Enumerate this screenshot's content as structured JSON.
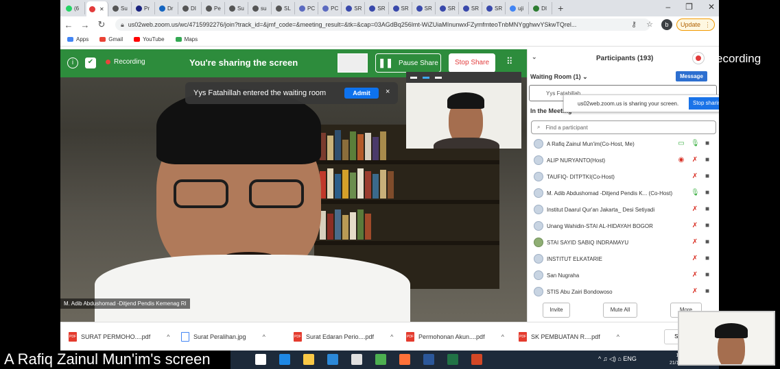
{
  "browser": {
    "tabs": [
      {
        "label": "(6",
        "color": "#25d366"
      },
      {
        "label": "",
        "color": "#e23b3b",
        "active": true
      },
      {
        "label": "Su",
        "color": "#555"
      },
      {
        "label": "Pr",
        "color": "#1a237e"
      },
      {
        "label": "Dr",
        "color": "#1565c0"
      },
      {
        "label": "DI",
        "color": "#555"
      },
      {
        "label": "Pe",
        "color": "#555"
      },
      {
        "label": "Su",
        "color": "#555"
      },
      {
        "label": "su",
        "color": "#555"
      },
      {
        "label": "SL",
        "color": "#555"
      },
      {
        "label": "PC",
        "color": "#5c6bc0"
      },
      {
        "label": "PC",
        "color": "#5c6bc0"
      },
      {
        "label": "SR",
        "color": "#3949ab"
      },
      {
        "label": "SR",
        "color": "#3949ab"
      },
      {
        "label": "SR",
        "color": "#3949ab"
      },
      {
        "label": "SR",
        "color": "#3949ab"
      },
      {
        "label": "SR",
        "color": "#3949ab"
      },
      {
        "label": "SR",
        "color": "#3949ab"
      },
      {
        "label": "SR",
        "color": "#3949ab"
      },
      {
        "label": "uji",
        "color": "#4285f4"
      },
      {
        "label": "DI",
        "color": "#2e7d32"
      }
    ],
    "new_tab": "+",
    "window_controls": [
      "–",
      "❐",
      "✕"
    ],
    "url": "us02web.zoom.us/wc/4715992276/join?track_id=&jmf_code=&meeting_result=&tk=&cap=03AGdBq256lmt-WiZUiaMInunwxFZymfmteoTnbMNYgghwvYSkwTQrel...",
    "profile_initial": "b",
    "update_label": "Update",
    "bookmarks": [
      {
        "label": "Apps",
        "color": "#4285f4"
      },
      {
        "label": "Gmail",
        "color": "#ea4335"
      },
      {
        "label": "YouTube",
        "color": "#ff0000"
      },
      {
        "label": "Maps",
        "color": "#34a853"
      }
    ]
  },
  "zoom": {
    "share_bar": {
      "recording": "Recording",
      "title": "You're sharing the screen",
      "pause": "Pause Share",
      "stop": "Stop Share"
    },
    "notification": {
      "text": "Yys Fatahillah entered the waiting room",
      "admit": "Admit",
      "close": "×"
    },
    "video_label": "M. Adib Abdushomad -Ditjend Pendis Kemenag RI"
  },
  "participants_panel": {
    "title": "Participants (193)",
    "waiting_room": "Waiting Room (1)",
    "message_btn": "Message",
    "waiting_name": "Yys Fatahillah",
    "in_meeting": "In the Meeting",
    "sharing_notice": "us02web.zoom.us is sharing your screen.",
    "sharing_stop": "Stop sharing",
    "find_placeholder": "Find a participant",
    "participants": [
      {
        "name": "A Rafiq Zainul Mun'im(Co-Host, Me)",
        "mic": "on",
        "screen": true
      },
      {
        "name": "ALIP NURYANTO(Host)",
        "mic": "off",
        "rec": true
      },
      {
        "name": "TAUFIQ- DITPTKI(Co-Host)",
        "mic": "off"
      },
      {
        "name": "M. Adib Abdushomad -Ditjend Pendis K... (Co-Host)",
        "mic": "on"
      },
      {
        "name": "Institut Daarul Qur'an Jakarta_ Desi Setiyadi",
        "mic": "off"
      },
      {
        "name": "Unang Wahidin-STAI AL-HIDAYAH BOGOR",
        "mic": "off"
      },
      {
        "name": "STAI SAYID SABIQ INDRAMAYU",
        "mic": "off",
        "green_avatar": true
      },
      {
        "name": "INSTITUT ELKATARIE",
        "mic": "off"
      },
      {
        "name": "San Nugraha",
        "mic": "off"
      },
      {
        "name": "STIS Abu Zairi Bondowoso",
        "mic": "off"
      }
    ],
    "invite": "Invite",
    "mute_all": "Mute All",
    "more": "More"
  },
  "downloads": [
    {
      "name": "SURAT PERMOHO....pdf",
      "type": "pdf"
    },
    {
      "name": "Surat Peralihan.jpg",
      "type": "img"
    },
    {
      "name": "Surat Edaran Perio....pdf",
      "type": "pdf"
    },
    {
      "name": "Permohonan Akun....pdf",
      "type": "pdf"
    },
    {
      "name": "SK PEMBUATAN R....pdf",
      "type": "pdf"
    }
  ],
  "download_show_all": "Sh",
  "taskbar": {
    "apps": [
      {
        "name": "task-view",
        "color": "#ffffff"
      },
      {
        "name": "edge",
        "color": "#1e88e5"
      },
      {
        "name": "explorer",
        "color": "#f9c846"
      },
      {
        "name": "mail",
        "color": "#2b88d8"
      },
      {
        "name": "store",
        "color": "#e0e0e0"
      },
      {
        "name": "chrome",
        "color": "#4caf50"
      },
      {
        "name": "firefox",
        "color": "#ff7139"
      },
      {
        "name": "word",
        "color": "#2b579a"
      },
      {
        "name": "excel",
        "color": "#217346"
      },
      {
        "name": "powerpoint",
        "color": "#d24726"
      }
    ],
    "tray": "^ ♫ ◁) ⌂ ENG",
    "clock_time": "16",
    "clock_date": "21/11/20"
  },
  "overlays": {
    "screen_caption": "A Rafiq Zainul Mun'im's screen",
    "recording": "ecording"
  }
}
